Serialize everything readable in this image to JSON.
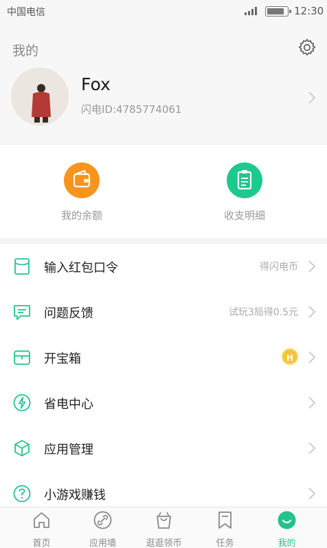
{
  "status_bar": {
    "carrier": "中国电信",
    "time": "12:30",
    "battery_level": 0.9,
    "signal_bars": 4
  },
  "header": {
    "title": "我的",
    "settings_icon": "gear-icon",
    "username": "Fox",
    "user_id": "闪电ID:4785774061"
  },
  "quick_actions": [
    {
      "label": "我的余额",
      "icon": "wallet-icon",
      "color": "#f7941d"
    },
    {
      "label": "收支明细",
      "icon": "clipboard-list-icon",
      "color": "#1ec98c"
    }
  ],
  "menu": [
    {
      "label": "输入红包口令",
      "extra": "得闪电币",
      "icon": "red-envelope-icon"
    },
    {
      "label": "问题反馈",
      "extra": "试玩3局得0.5元",
      "icon": "chat-bubble-icon"
    },
    {
      "label": "开宝箱",
      "extra": "",
      "icon": "treasure-box-icon",
      "badge": "H"
    },
    {
      "label": "省电中心",
      "extra": "",
      "icon": "lightning-icon"
    },
    {
      "label": "应用管理",
      "extra": "",
      "icon": "cube-icon"
    },
    {
      "label": "小游戏赚钱",
      "extra": "",
      "icon": "question-circle-icon"
    }
  ],
  "tabs": [
    {
      "label": "首页",
      "icon": "home-icon"
    },
    {
      "label": "应用墙",
      "icon": "link-icon"
    },
    {
      "label": "逛逛领币",
      "icon": "shopping-bag-icon"
    },
    {
      "label": "任务",
      "icon": "bookmark-icon"
    },
    {
      "label": "我的",
      "icon": "smile-icon",
      "active": true
    }
  ],
  "colors": {
    "accent": "#22c48a",
    "orange": "#f7941d",
    "text_muted": "#999999"
  }
}
